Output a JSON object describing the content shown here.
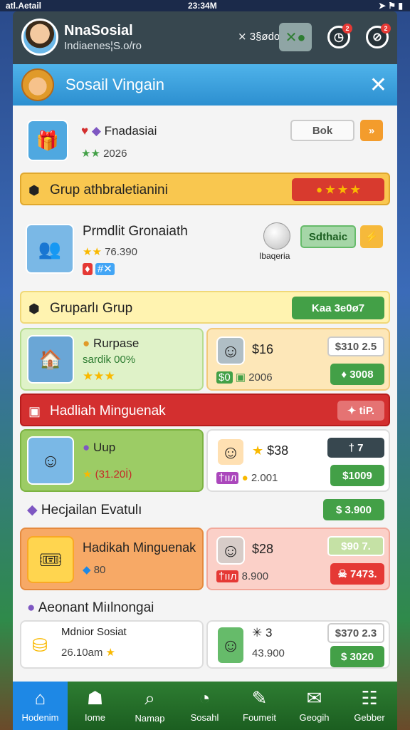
{
  "status": {
    "left": "atl.Aetail",
    "time": "23:34M",
    "right": "➤ ⚑ ▮"
  },
  "header": {
    "name": "NnaSosial",
    "subtitle": "Indiaenes¦S.o/ro",
    "coins": "⨯ 3§ødo",
    "notif_badge_1": "2",
    "notif_badge_2": "2"
  },
  "panel": {
    "title": "Sosail Vingain"
  },
  "row1": {
    "name": "Fnadasiai",
    "rating": "2026",
    "button": "Bok"
  },
  "banner1": {
    "label": "Grup athbraletianini"
  },
  "row2": {
    "name": "Prmdlit Gronaiath",
    "rating": "76.390",
    "button": "Sdthaic",
    "caption": "Ibaqeria"
  },
  "banner2": {
    "label": "Gruparlı Grup",
    "button": "Kaa 3e0ø7"
  },
  "card_a": {
    "title": "Rurpase",
    "sub": "sardik 00%"
  },
  "card_b": {
    "price": "$16",
    "value": "2006",
    "pill": "$310 2.5",
    "button": "♦ 3008",
    "chip": "$0"
  },
  "banner3": {
    "label": "Hadliah Minguenak",
    "button": "✦ tiP."
  },
  "card_c": {
    "title": "Uup",
    "sub": "(31.20İ)"
  },
  "card_d": {
    "price": "$38",
    "value": "2.001",
    "pill": "† 7",
    "button": "$1009",
    "chip": "†ııл"
  },
  "section4": {
    "label": "Hecjailan Evatulı",
    "button": "$ 3.900"
  },
  "card_e": {
    "title": "Hadikah Minguenak",
    "sub": "80"
  },
  "card_f": {
    "price": "$28",
    "value": "8.900",
    "pill": "$90 7.",
    "button": "☠ 7473.",
    "chip": "†ııл"
  },
  "section5": {
    "label": "Aeonant Miılnongai"
  },
  "card_g": {
    "title": "Mdnior Sosiat",
    "sub": "26.10am"
  },
  "card_h": {
    "price": "✳ 3",
    "value": "43.900",
    "pill": "$370 2.3",
    "button": "$ 3020"
  },
  "nav": [
    {
      "icon": "home-icon",
      "glyph": "⌂",
      "label": "Hodenim"
    },
    {
      "icon": "house-icon",
      "glyph": "☗",
      "label": "Iome"
    },
    {
      "icon": "search-icon",
      "glyph": "⌕",
      "label": "Namap"
    },
    {
      "icon": "compass-icon",
      "glyph": "◔",
      "label": "Sosahl"
    },
    {
      "icon": "feather-icon",
      "glyph": "✎",
      "label": "Foumeit"
    },
    {
      "icon": "chat-icon",
      "glyph": "✉",
      "label": "Geogih"
    },
    {
      "icon": "grid-icon",
      "glyph": "☷",
      "label": "Gebber"
    }
  ],
  "colors": {
    "accent": "#2c8fd0",
    "nav": "#2e7d32",
    "active": "#1e88e5"
  }
}
